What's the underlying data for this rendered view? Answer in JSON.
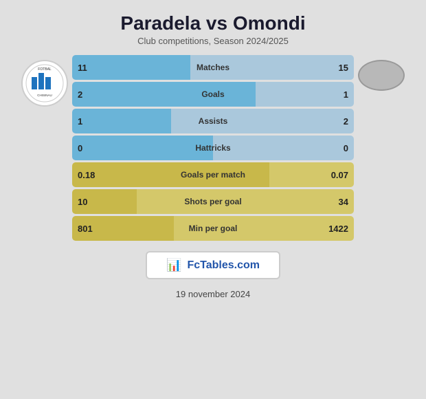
{
  "title": "Paradela vs Omondi",
  "subtitle": "Club competitions, Season 2024/2025",
  "date": "19 november 2024",
  "stats": [
    {
      "label": "Matches",
      "left_val": "11",
      "right_val": "15",
      "left_pct": 42,
      "right_pct": 58,
      "bar_color": "blue"
    },
    {
      "label": "Goals",
      "left_val": "2",
      "right_val": "1",
      "left_pct": 65,
      "right_pct": 35,
      "bar_color": "blue"
    },
    {
      "label": "Assists",
      "left_val": "1",
      "right_val": "2",
      "left_pct": 35,
      "right_pct": 65,
      "bar_color": "blue"
    },
    {
      "label": "Hattricks",
      "left_val": "0",
      "right_val": "0",
      "left_pct": 50,
      "right_pct": 50,
      "bar_color": "blue"
    },
    {
      "label": "Goals per match",
      "left_val": "0.18",
      "right_val": "0.07",
      "left_pct": 70,
      "right_pct": 30,
      "bar_color": "olive"
    },
    {
      "label": "Shots per goal",
      "left_val": "10",
      "right_val": "34",
      "left_pct": 23,
      "right_pct": 77,
      "bar_color": "olive"
    },
    {
      "label": "Min per goal",
      "left_val": "801",
      "right_val": "1422",
      "left_pct": 36,
      "right_pct": 64,
      "bar_color": "olive"
    }
  ],
  "fctables": {
    "text": "FcTables.com",
    "icon": "📊"
  },
  "colors": {
    "bg": "#4a4a4a",
    "content_bg": "#e0e0e0",
    "bar_blue_left": "#6ab4d8",
    "bar_blue_right": "#aacce0",
    "bar_olive": "#c8b84a",
    "bar_base": "#aac8dc"
  }
}
